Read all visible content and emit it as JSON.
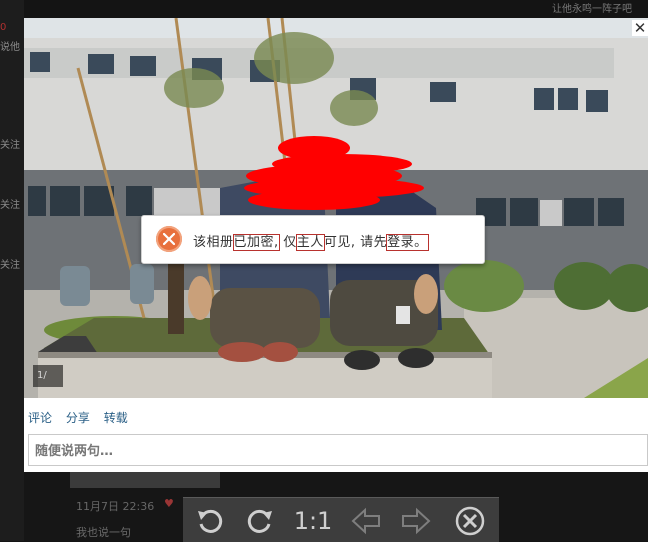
{
  "background_page": {
    "top_text": "让他永鸣一阵子吧",
    "left_items": [
      "说他",
      "关注",
      "关注",
      "关注"
    ],
    "post_date": "11月7日 22:36",
    "comment_prompt": "我也说一句"
  },
  "viewer": {
    "close_label": "✕",
    "counter": "1/",
    "alert": {
      "part1": "该相册",
      "highlight1": "已加密,",
      "part2": " 仅",
      "highlight2": "主人",
      "part3": "可见, 请先",
      "highlight3": "登录。"
    },
    "actions": [
      "评论",
      "分享",
      "转载"
    ],
    "comment_placeholder": "随便说两句…"
  },
  "toolbar": {
    "zoom_label": "1:1",
    "icons": [
      "rotate-left-icon",
      "rotate-right-icon",
      "zoom-actual-size",
      "prev-arrow-icon",
      "next-arrow-icon",
      "close-circle-icon"
    ]
  },
  "colors": {
    "alert_icon": "#e8703d",
    "highlight_border": "#b8322e",
    "link": "#2a5f86",
    "toolbar_bg": "#3d3d3d"
  }
}
